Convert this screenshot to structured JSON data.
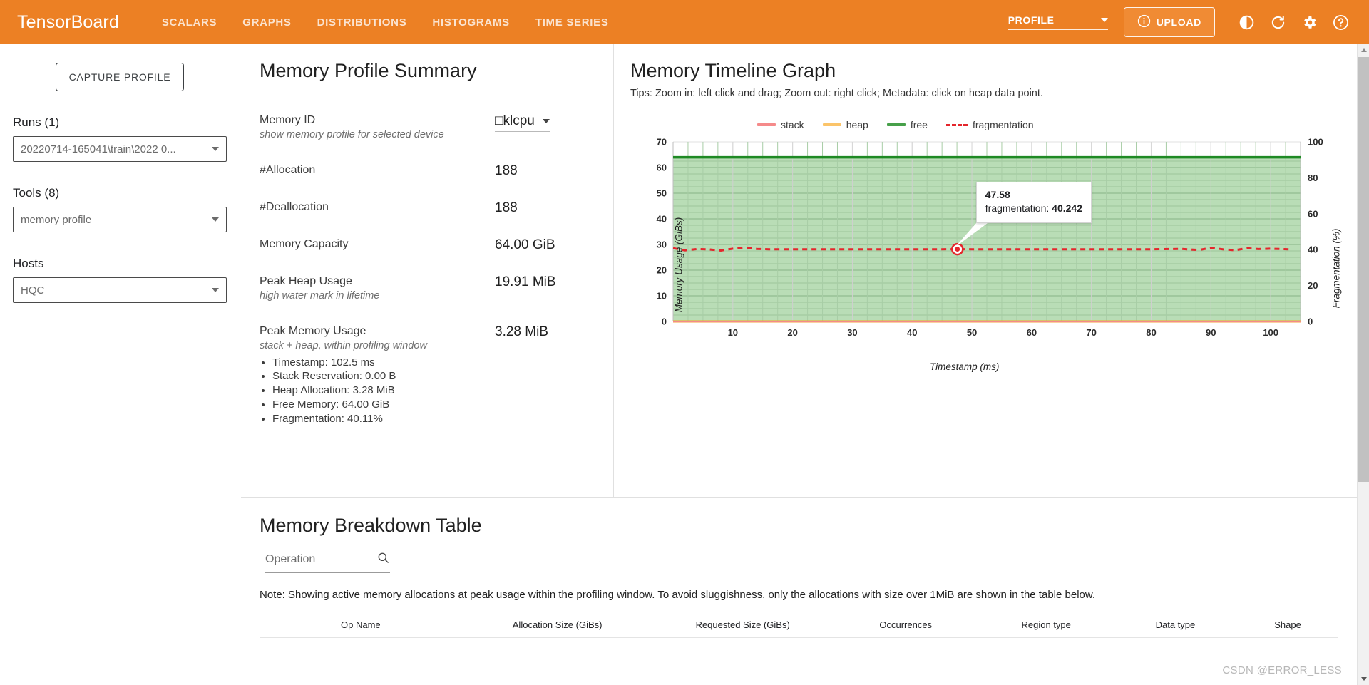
{
  "header": {
    "brand": "TensorBoard",
    "tabs": [
      {
        "label": "SCALARS"
      },
      {
        "label": "GRAPHS"
      },
      {
        "label": "DISTRIBUTIONS"
      },
      {
        "label": "HISTOGRAMS"
      },
      {
        "label": "TIME SERIES"
      }
    ],
    "plugin_selected": "PROFILE",
    "upload_label": "UPLOAD",
    "icons": [
      "info-icon",
      "brightness-icon",
      "refresh-icon",
      "gear-icon",
      "help-icon"
    ],
    "accent_color": "#ec8024"
  },
  "sidebar": {
    "capture_button": "CAPTURE PROFILE",
    "runs_label": "Runs (1)",
    "runs_value": "20220714-165041\\train\\2022 0...",
    "tools_label": "Tools (8)",
    "tools_value": "memory profile",
    "hosts_label": "Hosts",
    "hosts_value": "HQC"
  },
  "summary": {
    "title": "Memory Profile Summary",
    "rows": [
      {
        "name": "Memory ID",
        "sub": "show memory profile for selected device",
        "value": "□klcpu",
        "is_select": true
      },
      {
        "name": "#Allocation",
        "sub": "",
        "value": "188",
        "is_select": false
      },
      {
        "name": "#Deallocation",
        "sub": "",
        "value": "188",
        "is_select": false
      },
      {
        "name": "Memory Capacity",
        "sub": "",
        "value": "64.00 GiB",
        "is_select": false
      },
      {
        "name": "Peak Heap Usage",
        "sub": "high water mark in lifetime",
        "value": "19.91 MiB",
        "is_select": false
      },
      {
        "name": "Peak Memory Usage",
        "sub": "stack + heap, within profiling window",
        "value": "3.28 MiB",
        "is_select": false
      }
    ],
    "peak_details": [
      "Timestamp: 102.5 ms",
      "Stack Reservation: 0.00 B",
      "Heap Allocation: 3.28 MiB",
      "Free Memory: 64.00 GiB",
      "Fragmentation: 40.11%"
    ]
  },
  "timeline": {
    "title": "Memory Timeline Graph",
    "tips": "Tips: Zoom in: left click and drag; Zoom out: right click; Metadata: click on heap data point.",
    "tooltip": {
      "timestamp": "47.58",
      "label": "fragmentation:",
      "value": "40.242"
    }
  },
  "chart_data": {
    "type": "area",
    "title": "Memory Timeline Graph",
    "xlabel": "Timestamp (ms)",
    "ylabel": "Memory Usage (GiBs)",
    "y2label": "Fragmentation (%)",
    "xlim": [
      0,
      105
    ],
    "ylim": [
      0,
      70
    ],
    "y2lim": [
      0,
      100
    ],
    "xticks": [
      10,
      20,
      30,
      40,
      50,
      60,
      70,
      80,
      90,
      100
    ],
    "yticks": [
      0,
      10,
      20,
      30,
      40,
      50,
      60,
      70
    ],
    "y2ticks": [
      0,
      20,
      40,
      60,
      80,
      100
    ],
    "grid": true,
    "legend_position": "top",
    "legend": [
      {
        "name": "stack",
        "color": "#f58a8a",
        "style": "solid"
      },
      {
        "name": "heap",
        "color": "#fbc46a",
        "style": "solid"
      },
      {
        "name": "free",
        "color": "#47a04a",
        "style": "solid"
      },
      {
        "name": "fragmentation",
        "color": "#e4262c",
        "style": "dashed"
      }
    ],
    "series": [
      {
        "name": "free",
        "axis": "left",
        "unit": "GiB",
        "fill": "#b9ddb6",
        "color": "#1f8a24",
        "constant_value": 64.0,
        "x": [
          0,
          10,
          20,
          30,
          40,
          50,
          60,
          70,
          80,
          90,
          100,
          105
        ],
        "values": [
          64.0,
          64.0,
          64.0,
          64.0,
          64.0,
          64.0,
          64.0,
          64.0,
          64.0,
          64.0,
          64.0,
          64.0
        ]
      },
      {
        "name": "heap",
        "axis": "left",
        "unit": "GiB",
        "color": "#f5a623",
        "constant_value": 0.0,
        "x": [
          0,
          10,
          20,
          30,
          40,
          50,
          60,
          70,
          80,
          90,
          100,
          105
        ],
        "values": [
          0.0,
          0.0,
          0.0,
          0.0,
          0.0,
          0.0,
          0.0,
          0.0,
          0.0,
          0.0,
          0.0,
          0.0
        ]
      },
      {
        "name": "stack",
        "axis": "left",
        "unit": "GiB",
        "color": "#f58a8a",
        "constant_value": 0.0,
        "x": [
          0,
          10,
          20,
          30,
          40,
          50,
          60,
          70,
          80,
          90,
          100,
          105
        ],
        "values": [
          0.0,
          0.0,
          0.0,
          0.0,
          0.0,
          0.0,
          0.0,
          0.0,
          0.0,
          0.0,
          0.0,
          0.0
        ]
      },
      {
        "name": "fragmentation",
        "axis": "right",
        "unit": "%",
        "color": "#e4262c",
        "style": "dashed",
        "x": [
          0,
          2,
          4,
          6,
          8,
          10,
          12,
          14,
          16,
          18,
          20,
          25,
          30,
          35,
          40,
          45,
          47.58,
          50,
          55,
          60,
          65,
          70,
          75,
          80,
          85,
          88,
          90,
          92,
          94,
          96,
          98,
          100,
          103
        ],
        "values": [
          40.8,
          39.6,
          40.3,
          40.1,
          39.5,
          40.5,
          41.2,
          40.4,
          40.2,
          40.2,
          40.2,
          40.2,
          40.2,
          40.2,
          40.2,
          40.2,
          40.242,
          40.2,
          40.2,
          40.2,
          40.2,
          40.2,
          40.2,
          40.2,
          40.4,
          39.8,
          41.0,
          40.2,
          39.7,
          40.8,
          40.3,
          40.5,
          40.2
        ]
      }
    ],
    "annotations": [
      {
        "type": "point-tooltip",
        "x": 47.58,
        "y": 40.242,
        "text": "47.58 / fragmentation: 40.242"
      }
    ]
  },
  "breakdown": {
    "title": "Memory Breakdown Table",
    "search_placeholder": "Operation",
    "note": "Note: Showing active memory allocations at peak usage within the profiling window. To avoid sluggishness, only the allocations with size over 1MiB are shown in the table below.",
    "columns": [
      "Op Name",
      "Allocation Size (GiBs)",
      "Requested Size (GiBs)",
      "Occurrences",
      "Region type",
      "Data type",
      "Shape"
    ],
    "rows": []
  },
  "watermark": "CSDN @ERROR_LESS"
}
